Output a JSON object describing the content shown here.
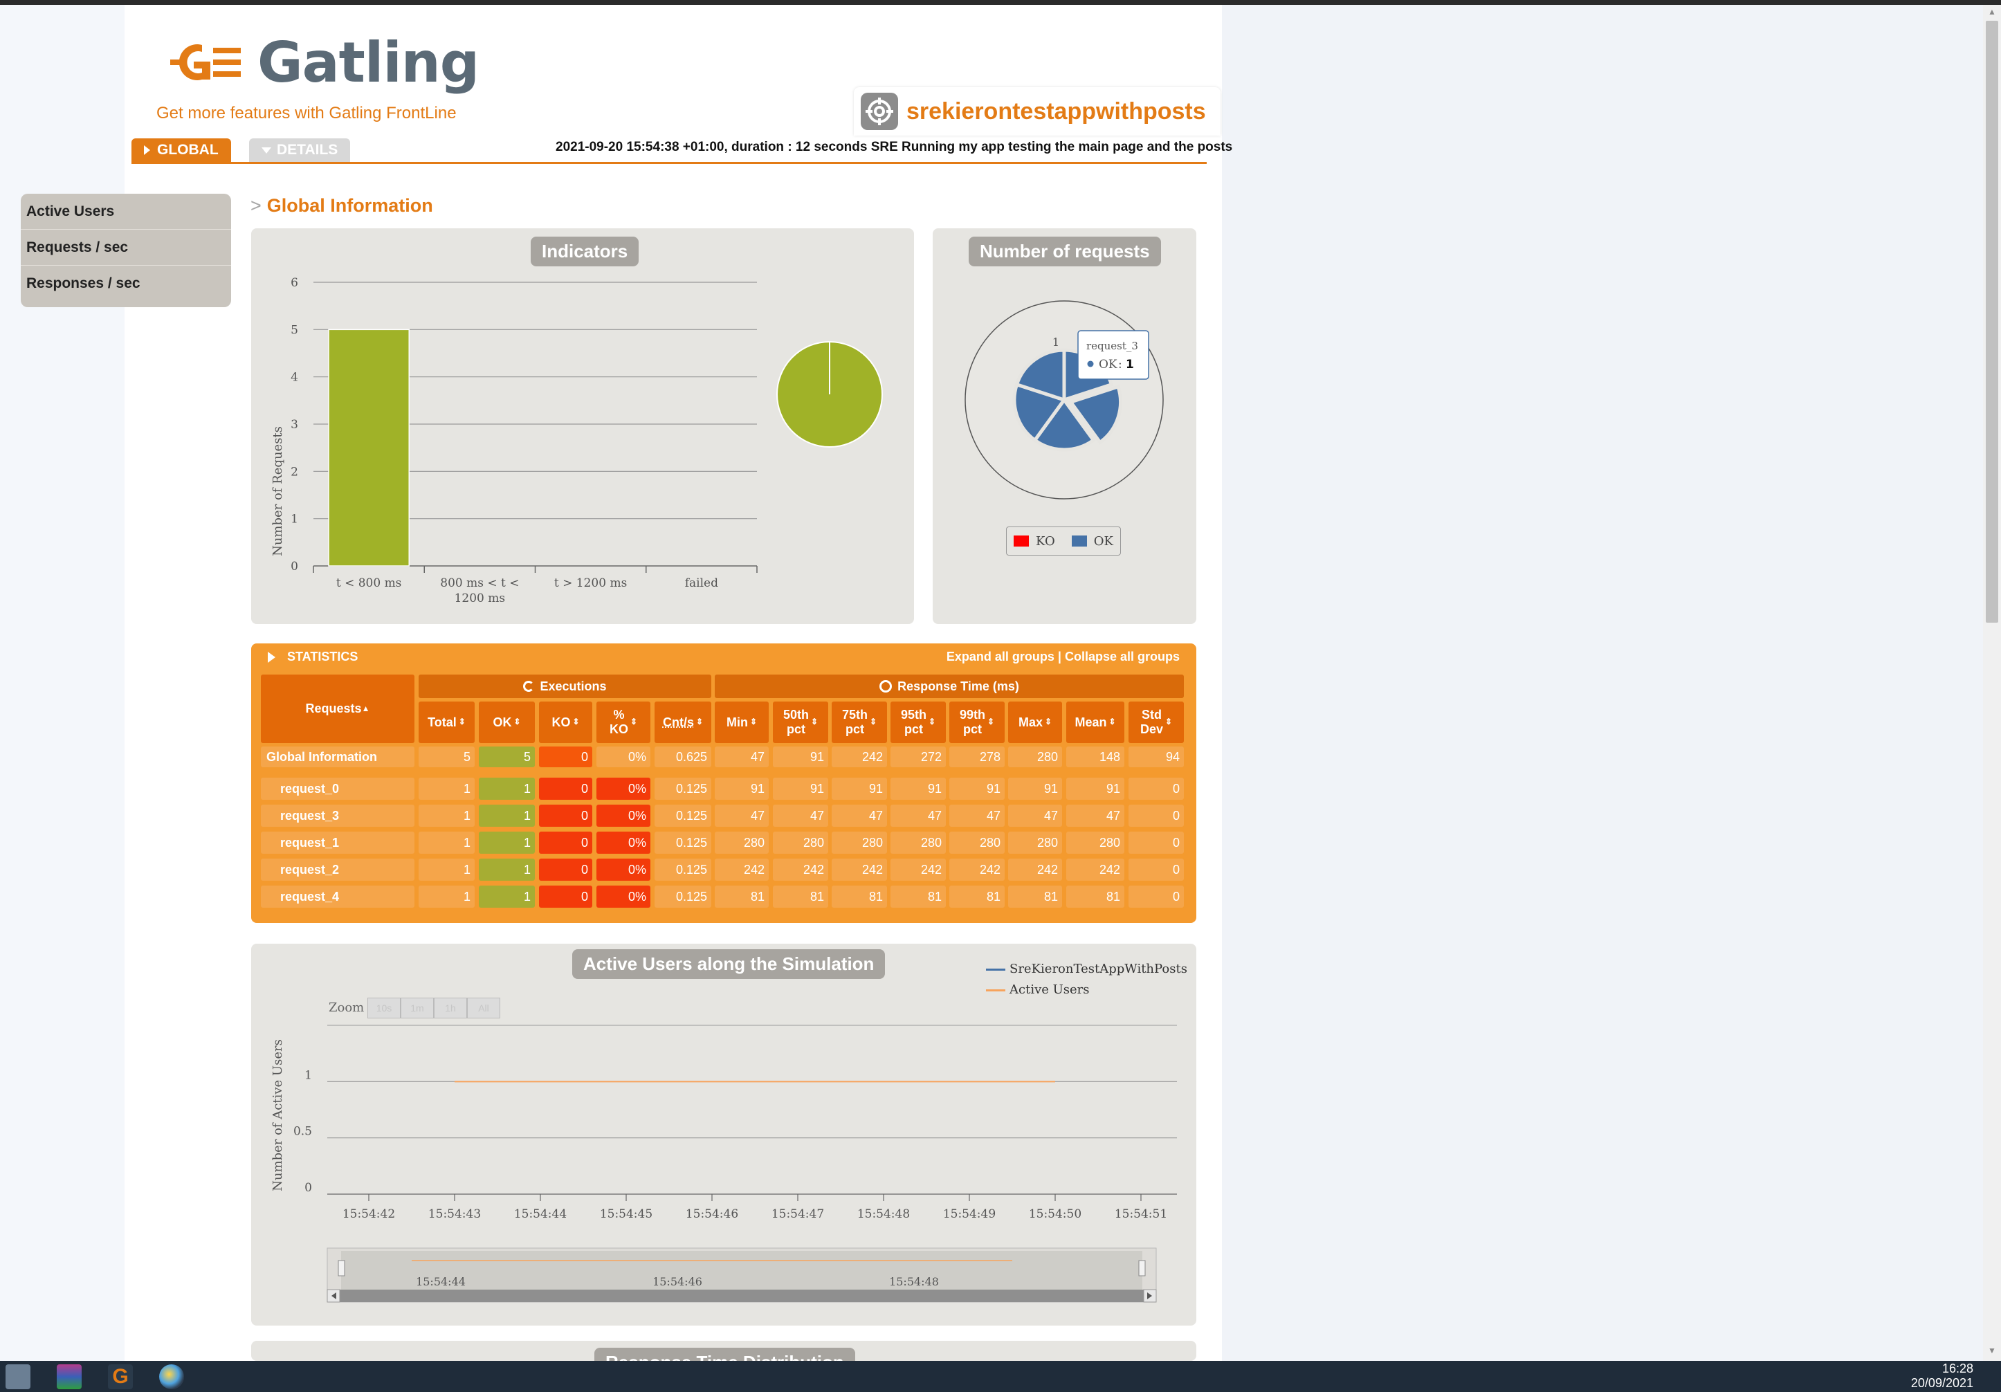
{
  "app": {
    "logo_text": "Gatling",
    "frontline_link": "Get more features with Gatling FrontLine",
    "simulation_name": "srekierontestappwithposts"
  },
  "tabs": {
    "global": "GLOBAL",
    "details": "DETAILS"
  },
  "run_info": "2021-09-20 15:54:38 +01:00, duration : 12 seconds SRE Running my app testing the main page and the posts",
  "sidebar": {
    "items": [
      {
        "label": "Active Users"
      },
      {
        "label": "Requests / sec"
      },
      {
        "label": "Responses / sec"
      }
    ]
  },
  "section": {
    "gt": ">",
    "title": "Global Information"
  },
  "indicators": {
    "title": "Indicators",
    "ylabel": "Number of Requests",
    "chart_data": {
      "type": "bar",
      "categories": [
        "t < 800 ms",
        "800 ms < t < 1200 ms",
        "t > 1200 ms",
        "failed"
      ],
      "category_lines": [
        [
          "t < 800 ms"
        ],
        [
          "800 ms < t <",
          "1200 ms"
        ],
        [
          "t > 1200 ms"
        ],
        [
          "failed"
        ]
      ],
      "values": [
        5,
        0,
        0,
        0
      ],
      "ylim": [
        0,
        6
      ],
      "yticks": [
        "0",
        "1",
        "2",
        "3",
        "4",
        "5",
        "6"
      ],
      "bar_color": "#a0b228",
      "pie": {
        "values": [
          5,
          0,
          0,
          0
        ],
        "color": "#a0b228"
      }
    }
  },
  "requests_pie": {
    "title": "Number of requests",
    "chart_data": {
      "type": "pie",
      "slices": [
        {
          "label": "request_0",
          "value": 1
        },
        {
          "label": "request_3",
          "value": 1
        },
        {
          "label": "request_1",
          "value": 1
        },
        {
          "label": "request_2",
          "value": 1
        },
        {
          "label": "request_4",
          "value": 1
        }
      ],
      "ok_color": "#4572a7",
      "ko_color": "#ff0000"
    },
    "data_label": "1",
    "tooltip": {
      "name": "request_3",
      "series": "OK",
      "value": "1"
    },
    "legend": {
      "ko": "KO",
      "ok": "OK"
    }
  },
  "statistics": {
    "title": "STATISTICS",
    "links": "Expand all groups | Collapse all groups",
    "group_exec": "Executions",
    "group_resp": "Response Time (ms)",
    "headers": {
      "requests": "Requests",
      "total": "Total",
      "ok": "OK",
      "ko": "KO",
      "pko_1": "%",
      "pko_2": "KO",
      "cnts": "Cnt/s",
      "min": "Min",
      "p50_1": "50th",
      "p75_1": "75th",
      "p95_1": "95th",
      "p99_1": "99th",
      "pct": "pct",
      "max": "Max",
      "mean": "Mean",
      "std_1": "Std",
      "std_2": "Dev"
    },
    "global": {
      "name": "Global Information",
      "total": "5",
      "ok": "5",
      "ko": "0",
      "pko": "0%",
      "cnts": "0.625",
      "min": "47",
      "p50": "91",
      "p75": "242",
      "p95": "272",
      "p99": "278",
      "max": "280",
      "mean": "148",
      "std": "94"
    },
    "rows": [
      {
        "name": "request_0",
        "total": "1",
        "ok": "1",
        "ko": "0",
        "pko": "0%",
        "cnts": "0.125",
        "min": "91",
        "p50": "91",
        "p75": "91",
        "p95": "91",
        "p99": "91",
        "max": "91",
        "mean": "91",
        "std": "0"
      },
      {
        "name": "request_3",
        "total": "1",
        "ok": "1",
        "ko": "0",
        "pko": "0%",
        "cnts": "0.125",
        "min": "47",
        "p50": "47",
        "p75": "47",
        "p95": "47",
        "p99": "47",
        "max": "47",
        "mean": "47",
        "std": "0"
      },
      {
        "name": "request_1",
        "total": "1",
        "ok": "1",
        "ko": "0",
        "pko": "0%",
        "cnts": "0.125",
        "min": "280",
        "p50": "280",
        "p75": "280",
        "p95": "280",
        "p99": "280",
        "max": "280",
        "mean": "280",
        "std": "0"
      },
      {
        "name": "request_2",
        "total": "1",
        "ok": "1",
        "ko": "0",
        "pko": "0%",
        "cnts": "0.125",
        "min": "242",
        "p50": "242",
        "p75": "242",
        "p95": "242",
        "p99": "242",
        "max": "242",
        "mean": "242",
        "std": "0"
      },
      {
        "name": "request_4",
        "total": "1",
        "ok": "1",
        "ko": "0",
        "pko": "0%",
        "cnts": "0.125",
        "min": "81",
        "p50": "81",
        "p75": "81",
        "p95": "81",
        "p99": "81",
        "max": "81",
        "mean": "81",
        "std": "0"
      }
    ]
  },
  "active_users": {
    "title": "Active Users along the Simulation",
    "ylabel": "Number of Active Users",
    "zoom_label": "Zoom",
    "zoom_buttons": [
      "10s",
      "1m",
      "1h",
      "All"
    ],
    "legend": [
      "SreKieronTestAppWithPosts",
      "Active Users"
    ],
    "chart_data": {
      "type": "line",
      "x": [
        "15:54:42",
        "15:54:43",
        "15:54:44",
        "15:54:45",
        "15:54:46",
        "15:54:47",
        "15:54:48",
        "15:54:49",
        "15:54:50",
        "15:54:51"
      ],
      "series": [
        {
          "name": "SreKieronTestAppWithPosts",
          "color": "#4572a7",
          "values": []
        },
        {
          "name": "Active Users",
          "color": "#f7a35c",
          "points": [
            [
              "15:54:43",
              1
            ],
            [
              "15:54:50",
              1
            ]
          ]
        }
      ],
      "ylim": [
        0,
        1.5
      ],
      "yticks": [
        "0",
        "0.5",
        "1"
      ],
      "navigator_labels": [
        "15:54:44",
        "15:54:46",
        "15:54:48"
      ]
    }
  },
  "next_panel": {
    "title": "Response Time Distribution"
  },
  "taskbar": {
    "time": "16:28",
    "date": "20/09/2021"
  }
}
